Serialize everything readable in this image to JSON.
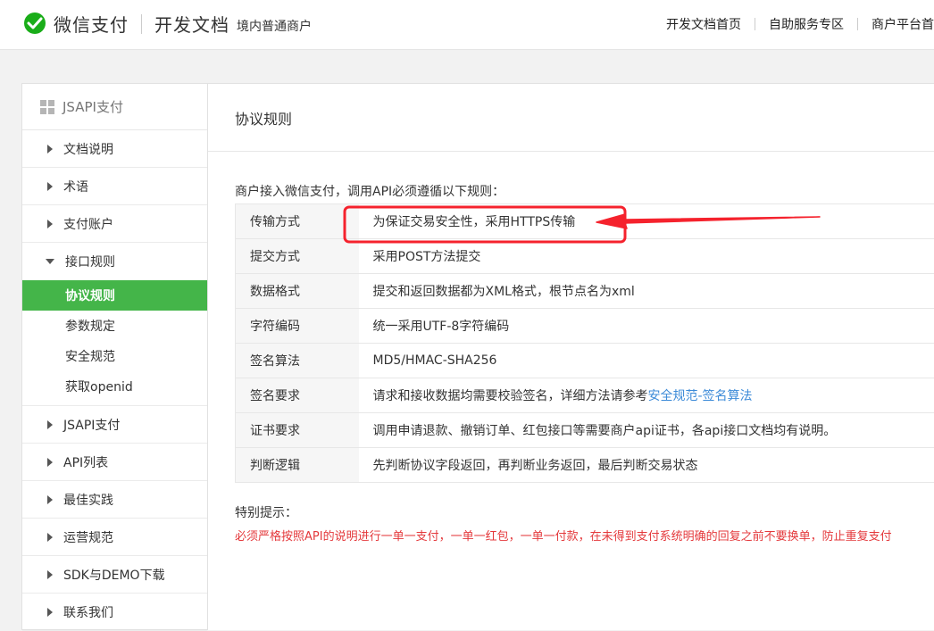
{
  "header": {
    "brand": "微信支付",
    "section": "开发文档",
    "tag": "境内普通商户",
    "nav": [
      "开发文档首页",
      "自助服务专区",
      "商户平台首"
    ]
  },
  "sidebar": {
    "title": "JSAPI支付",
    "items_before": [
      "文档说明",
      "术语",
      "支付账户"
    ],
    "expanded": {
      "label": "接口规则",
      "subitems": [
        "协议规则",
        "参数规定",
        "安全规范",
        "获取openid"
      ],
      "active_index": 0
    },
    "items_after": [
      "JSAPI支付",
      "API列表",
      "最佳实践",
      "运营规范",
      "SDK与DEMO下载",
      "联系我们"
    ]
  },
  "main": {
    "title": "协议规则",
    "intro": "商户接入微信支付，调用API必须遵循以下规则：",
    "rules": [
      {
        "key": "传输方式",
        "value": "为保证交易安全性，采用HTTPS传输"
      },
      {
        "key": "提交方式",
        "value": "采用POST方法提交"
      },
      {
        "key": "数据格式",
        "value": "提交和返回数据都为XML格式，根节点名为xml"
      },
      {
        "key": "字符编码",
        "value": "统一采用UTF-8字符编码"
      },
      {
        "key": "签名算法",
        "value": "MD5/HMAC-SHA256"
      },
      {
        "key": "签名要求",
        "value": "请求和接收数据均需要校验签名，详细方法请参考",
        "link": "安全规范-签名算法"
      },
      {
        "key": "证书要求",
        "value": "调用申请退款、撤销订单、红包接口等需要商户api证书，各api接口文档均有说明。"
      },
      {
        "key": "判断逻辑",
        "value": "先判断协议字段返回，再判断业务返回，最后判断交易状态"
      }
    ],
    "tip_title": "特别提示：",
    "tip_text": "必须严格按照API的说明进行一单一支付，一单一红包，一单一付款，在未得到支付系统明确的回复之前不要换单，防止重复支付"
  },
  "colors": {
    "accent_green": "#44b549",
    "link_blue": "#3d8bd8",
    "warning_red": "#e4393c",
    "annotation_red": "#f5222d"
  }
}
